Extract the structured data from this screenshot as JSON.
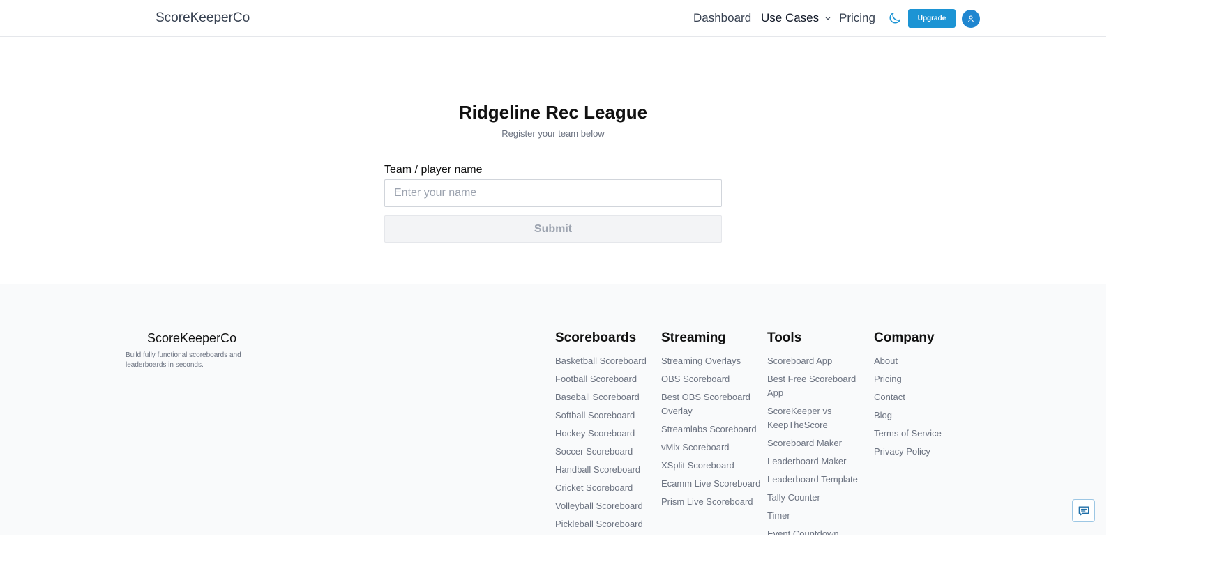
{
  "header": {
    "brand": "ScoreKeeperCo",
    "nav": {
      "dashboard": "Dashboard",
      "use_cases": "Use Cases",
      "pricing": "Pricing"
    },
    "upgrade_label": "Upgrade"
  },
  "main": {
    "title": "Ridgeline Rec League",
    "subtitle": "Register your team below",
    "field_label": "Team / player name",
    "input_placeholder": "Enter your name",
    "input_value": "",
    "submit_label": "Submit"
  },
  "footer": {
    "brand": "ScoreKeeperCo",
    "tagline": "Build fully functional scoreboards and leaderboards in seconds.",
    "columns": [
      {
        "heading": "Scoreboards",
        "links": [
          "Basketball Scoreboard",
          "Football Scoreboard",
          "Baseball Scoreboard",
          "Softball Scoreboard",
          "Hockey Scoreboard",
          "Soccer Scoreboard",
          "Handball Scoreboard",
          "Cricket Scoreboard",
          "Volleyball Scoreboard",
          "Pickleball Scoreboard"
        ]
      },
      {
        "heading": "Streaming",
        "links": [
          "Streaming Overlays",
          "OBS Scoreboard",
          "Best OBS Scoreboard Overlay",
          "Streamlabs Scoreboard",
          "vMix Scoreboard",
          "XSplit Scoreboard",
          "Ecamm Live Scoreboard",
          "Prism Live Scoreboard"
        ]
      },
      {
        "heading": "Tools",
        "links": [
          "Scoreboard App",
          "Best Free Scoreboard App",
          "ScoreKeeper vs KeepTheScore",
          "Scoreboard Maker",
          "Leaderboard Maker",
          "Leaderboard Template",
          "Tally Counter",
          "Timer",
          "Event Countdown"
        ]
      },
      {
        "heading": "Company",
        "links": [
          "About",
          "Pricing",
          "Contact",
          "Blog",
          "Terms of Service",
          "Privacy Policy"
        ]
      }
    ]
  },
  "icons": {
    "theme_toggle": "moon-icon",
    "use_cases_caret": "chevron-down-icon",
    "avatar": "user-icon",
    "chat": "chat-icon"
  },
  "colors": {
    "accent": "#1c94d4",
    "avatar": "#1f86d0",
    "footer_bg": "#f9fafb",
    "muted_text": "#6b7280"
  }
}
